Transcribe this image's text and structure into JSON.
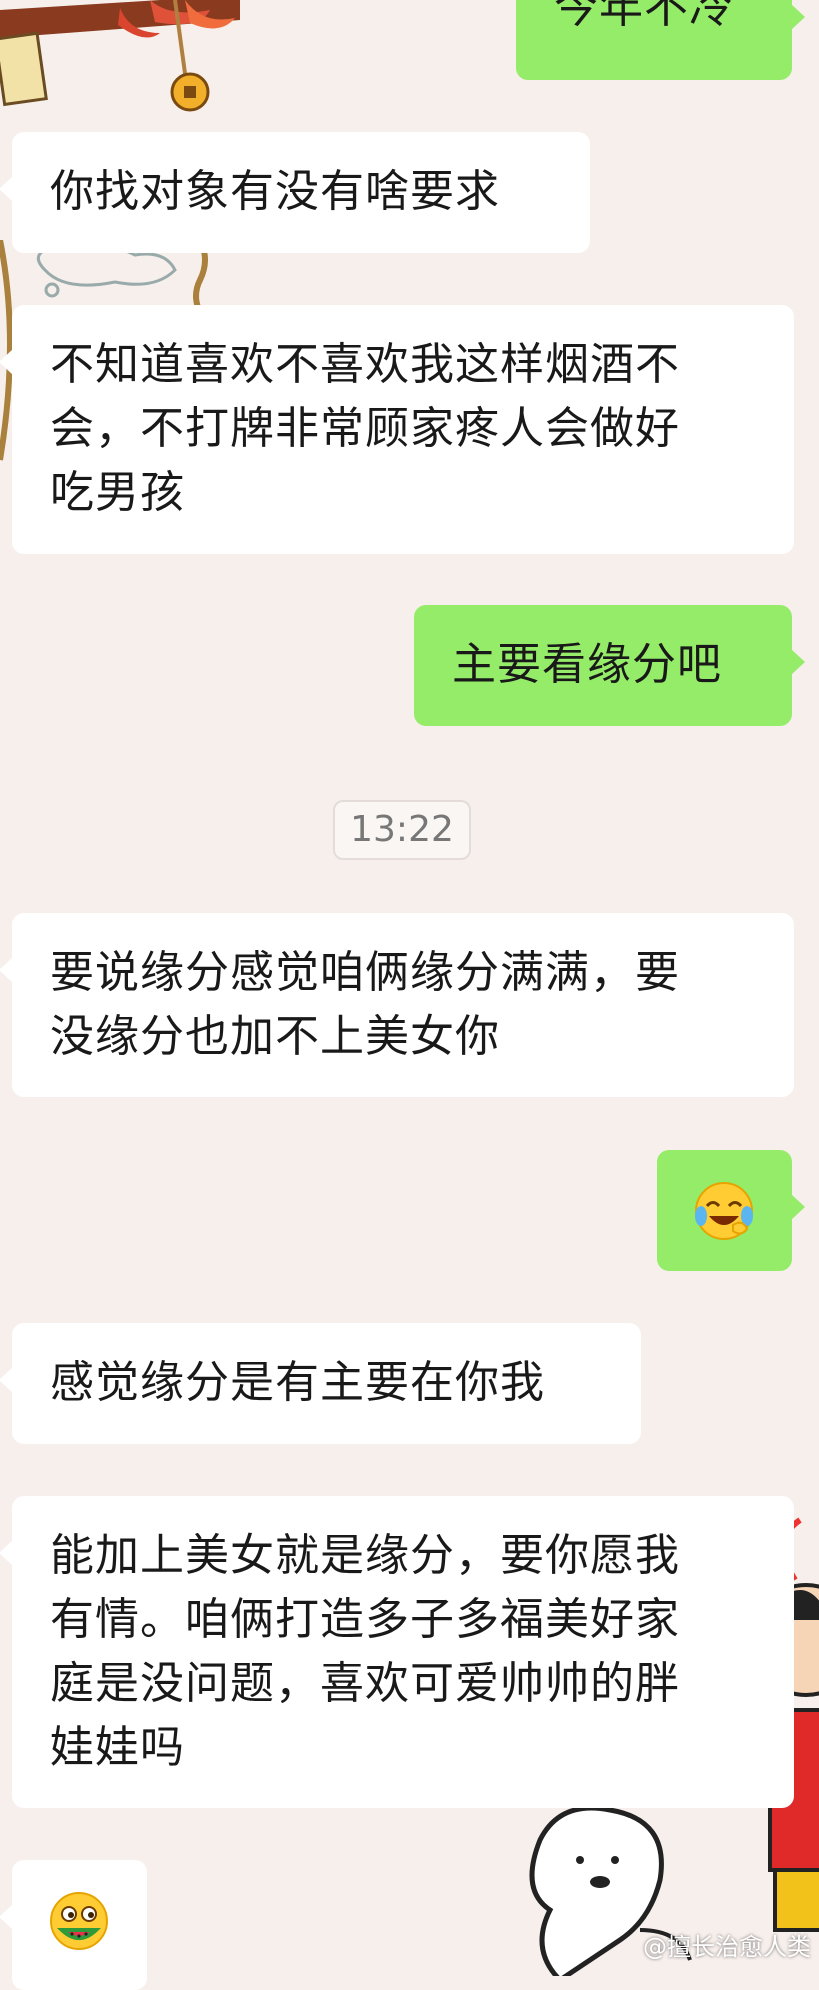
{
  "chat": {
    "messages": [
      {
        "side": "out",
        "text": "今年不冷"
      },
      {
        "side": "in",
        "text": "你找对象有没有啥要求"
      },
      {
        "side": "in",
        "text": "不知道喜欢不喜欢我这样烟酒不\n会，不打牌非常顾家疼人会做好\n吃男孩"
      },
      {
        "side": "out",
        "text": "主要看缘分吧"
      },
      {
        "side": "in",
        "text": "要说缘分感觉咱俩缘分满满，要\n没缘分也加不上美女你"
      },
      {
        "side": "out",
        "emoji": "face-with-tears-of-joy-emoji"
      },
      {
        "side": "in",
        "text": "感觉缘分是有主要在你我"
      },
      {
        "side": "in",
        "text": "能加上美女就是缘分，要你愿我\n有情。咱俩打造多子多福美好家\n庭是没问题，喜欢可爱帅帅的胖\n娃娃吗"
      },
      {
        "side": "in",
        "emoji": "eating-watermelon-emoji"
      }
    ],
    "timestamp": "13:22"
  },
  "watermark": "@擅长治愈人类",
  "colors": {
    "incoming_bubble": "#ffffff",
    "outgoing_bubble": "#95ec69",
    "background": "#f7efec",
    "text": "#191919"
  }
}
